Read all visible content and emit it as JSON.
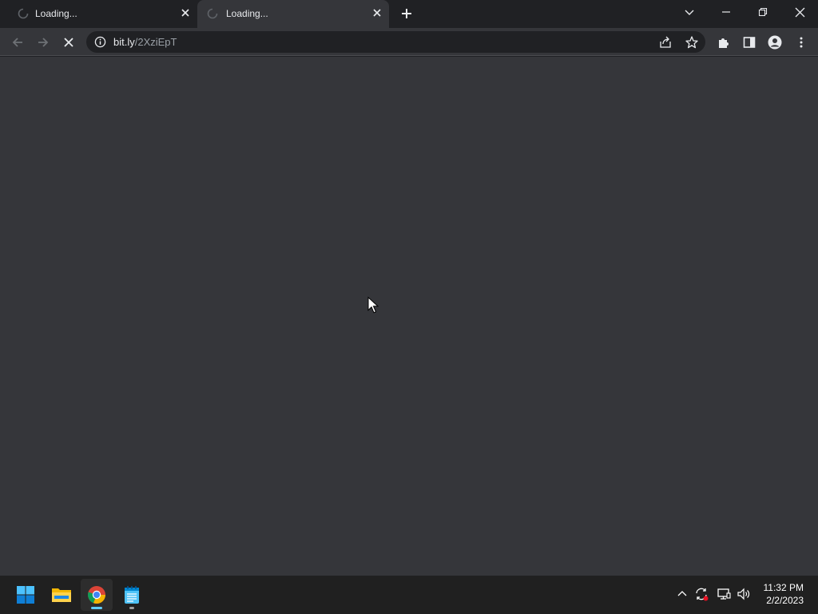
{
  "browser": {
    "tabs": [
      {
        "title": "Loading...",
        "active": false
      },
      {
        "title": "Loading...",
        "active": true
      }
    ],
    "address": {
      "host": "bit.ly",
      "path": "/2XziEpT"
    },
    "colors": {
      "frame": "#202124",
      "toolbar": "#35363a",
      "text": "#e8eaed",
      "muted": "#9aa0a6"
    }
  },
  "taskbar": {
    "apps": [
      "start-icon",
      "file-explorer-icon",
      "chrome-icon",
      "notepad-icon"
    ],
    "clock": {
      "time": "11:32 PM",
      "date": "2/2/2023"
    }
  }
}
